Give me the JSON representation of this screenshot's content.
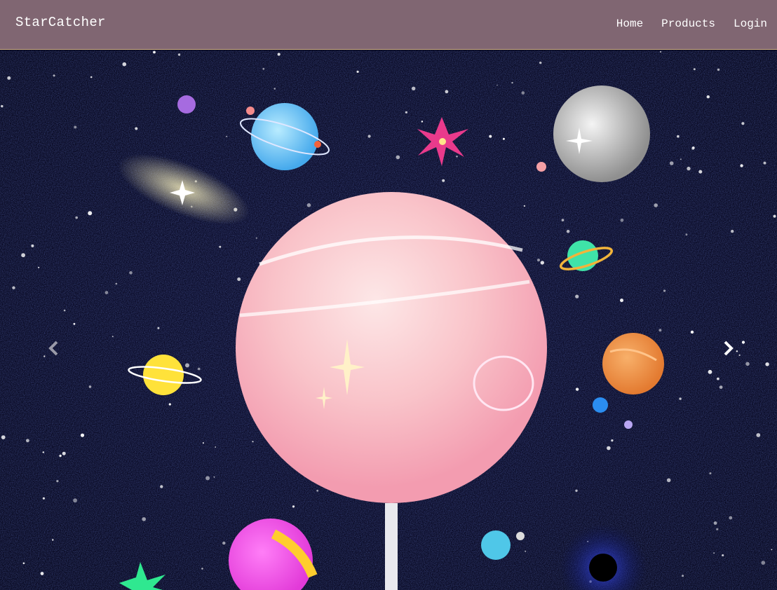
{
  "navbar": {
    "brand": "StarCatcher",
    "links": [
      {
        "label": "Home"
      },
      {
        "label": "Products"
      },
      {
        "label": "Login"
      }
    ],
    "colors": {
      "background": "#806672",
      "border": "#d2b38a",
      "text": "#ffffff"
    }
  },
  "carousel": {
    "slide_image": "space-lollipop-illustration",
    "controls": {
      "prev_icon": "chevron-left-icon",
      "next_icon": "chevron-right-icon"
    },
    "colors": {
      "sky": "#05051a",
      "lollipop": "#f7b3c0"
    }
  }
}
